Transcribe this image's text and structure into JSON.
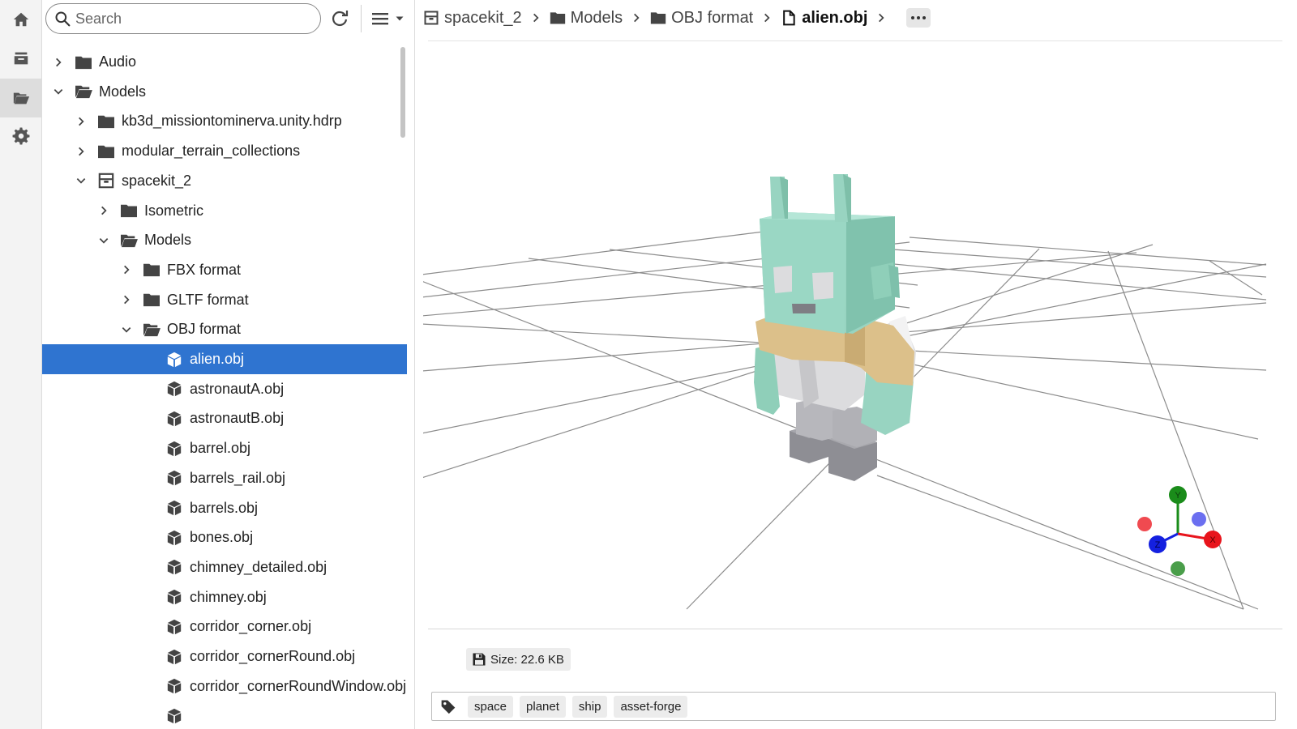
{
  "activity_bar": {
    "items": [
      {
        "name": "home",
        "icon": "home-icon",
        "active": false
      },
      {
        "name": "archive",
        "icon": "archive-icon",
        "active": false
      },
      {
        "name": "files",
        "icon": "folder-open-icon",
        "active": true
      },
      {
        "name": "settings",
        "icon": "gear-icon",
        "active": false
      }
    ]
  },
  "sidebar": {
    "search_placeholder": "Search",
    "tree": [
      {
        "label": "Audio",
        "depth": 0,
        "kind": "folder",
        "expanded": false
      },
      {
        "label": "Models",
        "depth": 0,
        "kind": "folder",
        "expanded": true
      },
      {
        "label": "kb3d_missiontominerva.unity.hdrp",
        "depth": 1,
        "kind": "folder",
        "expanded": false
      },
      {
        "label": "modular_terrain_collections",
        "depth": 1,
        "kind": "folder",
        "expanded": false
      },
      {
        "label": "spacekit_2",
        "depth": 1,
        "kind": "package",
        "expanded": true
      },
      {
        "label": "Isometric",
        "depth": 2,
        "kind": "folder",
        "expanded": false
      },
      {
        "label": "Models",
        "depth": 2,
        "kind": "folder",
        "expanded": true
      },
      {
        "label": "FBX format",
        "depth": 3,
        "kind": "folder",
        "expanded": false
      },
      {
        "label": "GLTF format",
        "depth": 3,
        "kind": "folder",
        "expanded": false
      },
      {
        "label": "OBJ format",
        "depth": 3,
        "kind": "folder",
        "expanded": true
      },
      {
        "label": "alien.obj",
        "depth": 4,
        "kind": "model",
        "selected": true
      },
      {
        "label": "astronautA.obj",
        "depth": 4,
        "kind": "model"
      },
      {
        "label": "astronautB.obj",
        "depth": 4,
        "kind": "model"
      },
      {
        "label": "barrel.obj",
        "depth": 4,
        "kind": "model"
      },
      {
        "label": "barrels_rail.obj",
        "depth": 4,
        "kind": "model"
      },
      {
        "label": "barrels.obj",
        "depth": 4,
        "kind": "model"
      },
      {
        "label": "bones.obj",
        "depth": 4,
        "kind": "model"
      },
      {
        "label": "chimney_detailed.obj",
        "depth": 4,
        "kind": "model"
      },
      {
        "label": "chimney.obj",
        "depth": 4,
        "kind": "model"
      },
      {
        "label": "corridor_corner.obj",
        "depth": 4,
        "kind": "model"
      },
      {
        "label": "corridor_cornerRound.obj",
        "depth": 4,
        "kind": "model"
      },
      {
        "label": "corridor_cornerRoundWindow.obj",
        "depth": 4,
        "kind": "model"
      },
      {
        "label": "",
        "depth": 4,
        "kind": "model"
      }
    ]
  },
  "breadcrumb": [
    {
      "label": "spacekit_2",
      "icon": "package-icon"
    },
    {
      "label": "Models",
      "icon": "folder-icon"
    },
    {
      "label": "OBJ format",
      "icon": "folder-icon"
    },
    {
      "label": "alien.obj",
      "icon": "file-icon",
      "current": true
    }
  ],
  "viewer": {
    "axis_labels": {
      "x": "X",
      "y": "Y",
      "z": "Z"
    }
  },
  "file_info": {
    "size_text": "Size: 22.6 KB"
  },
  "tags": [
    "space",
    "planet",
    "ship",
    "asset-forge"
  ],
  "colors": {
    "selection": "#2f74d0",
    "alien_head": "#98d4c1",
    "alien_shirt": "#dcc08a",
    "axis_x": "#e8141c",
    "axis_y": "#1a8c1a",
    "axis_z": "#1420e0"
  }
}
